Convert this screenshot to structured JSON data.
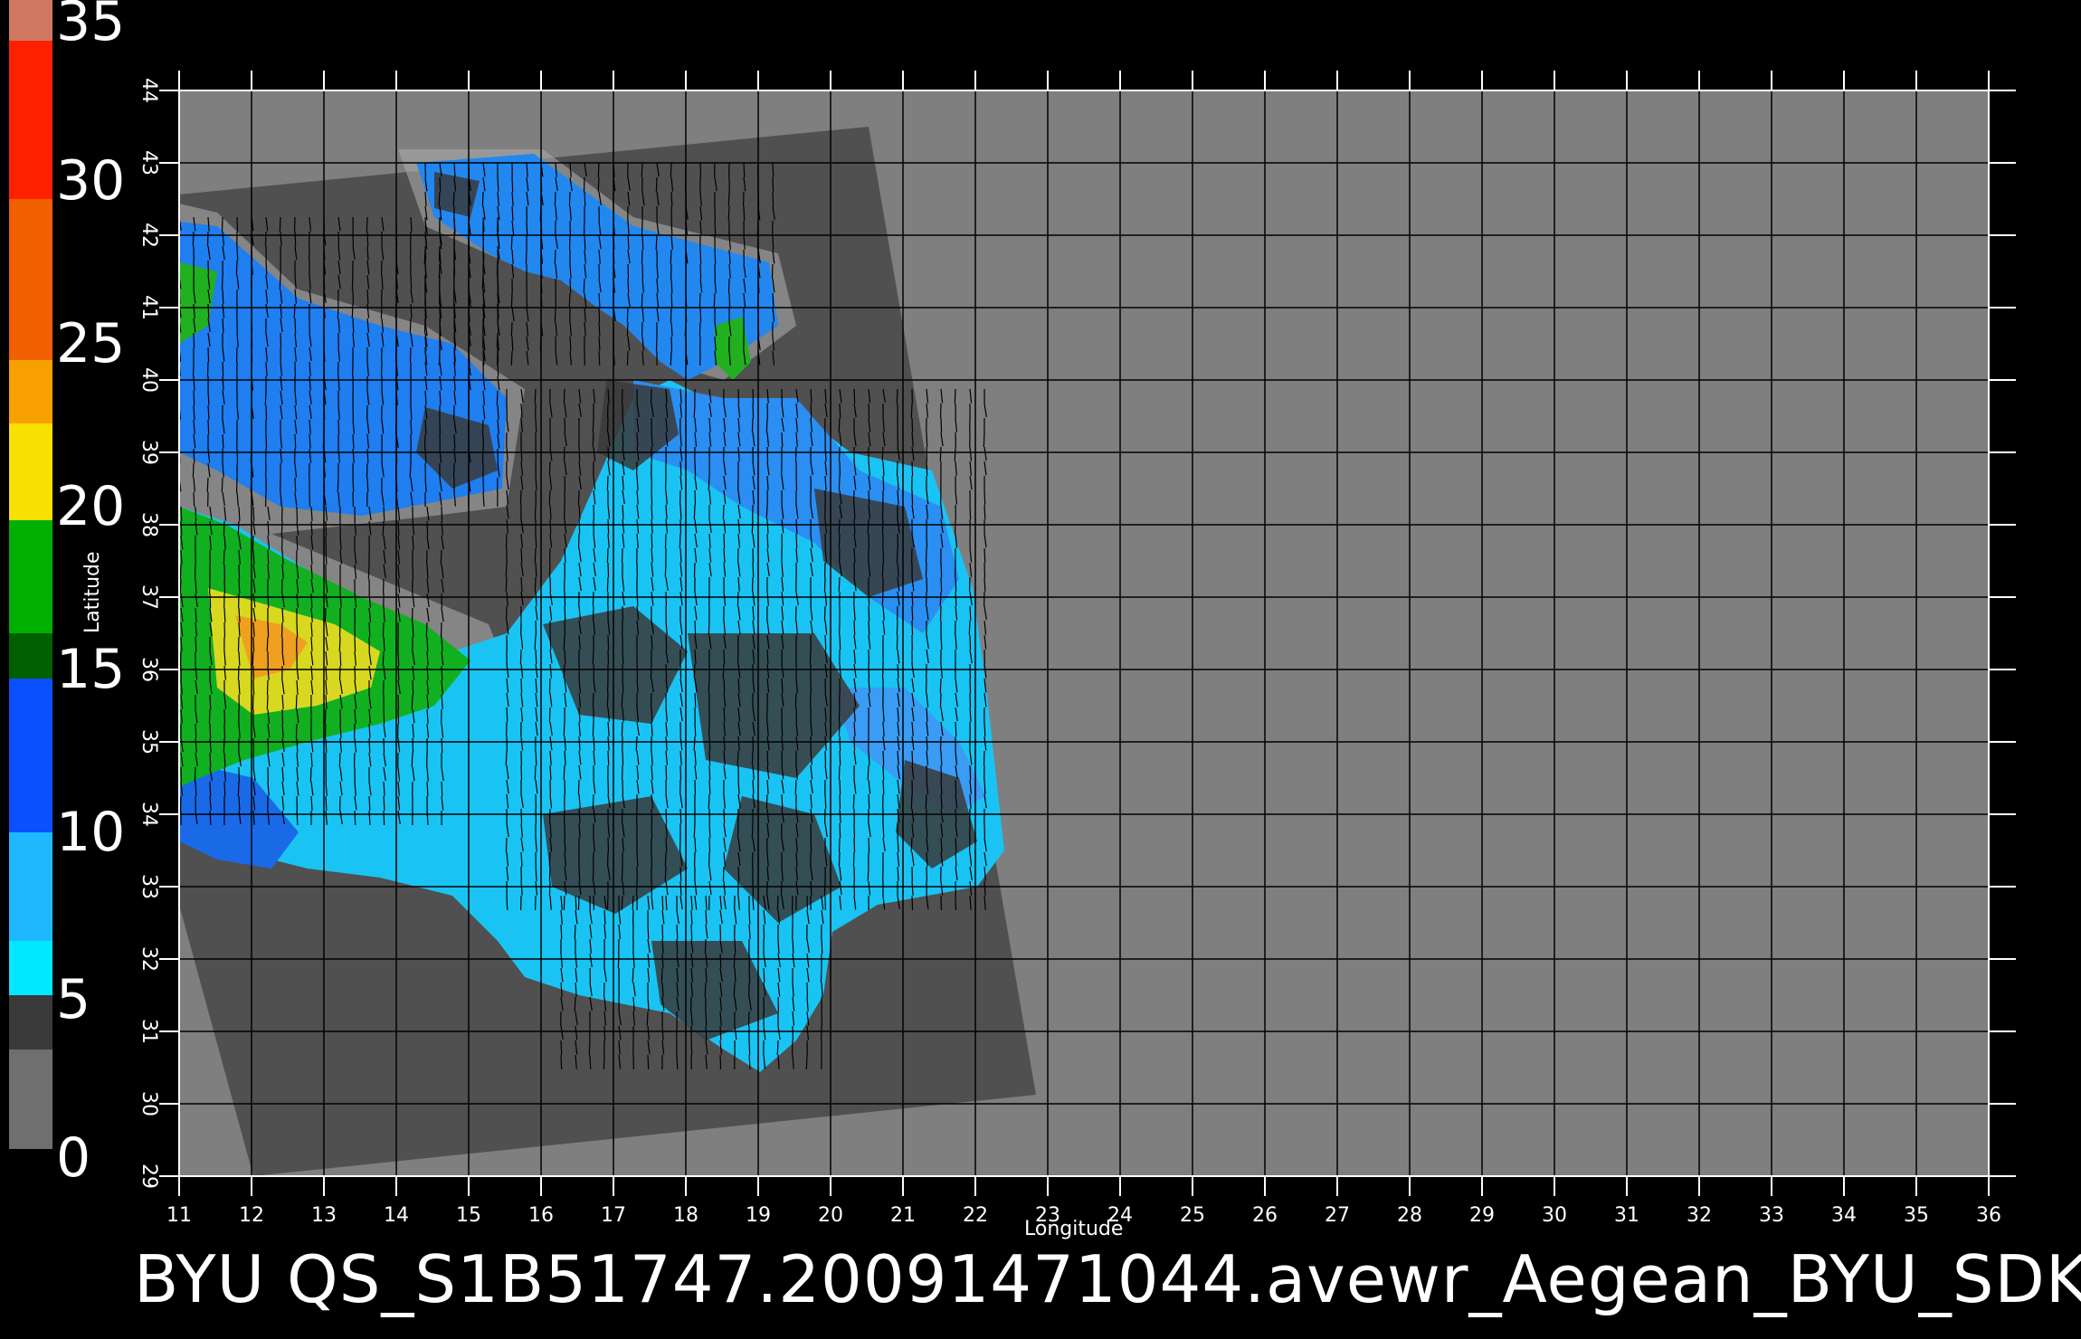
{
  "footer": {
    "title": "BYU  QS_S1B51747.20091471044.avewr_Aegean_BYU_SDK"
  },
  "axes": {
    "xlabel": "Longitude",
    "ylabel": "Latitude",
    "x_ticks": [
      "11",
      "12",
      "13",
      "14",
      "15",
      "16",
      "17",
      "18",
      "19",
      "20",
      "21",
      "22",
      "23",
      "24",
      "25",
      "26",
      "27",
      "28",
      "29",
      "30",
      "31",
      "32",
      "33",
      "34",
      "35",
      "36"
    ],
    "y_ticks": [
      "29",
      "30",
      "31",
      "32",
      "33",
      "34",
      "35",
      "36",
      "37",
      "38",
      "39",
      "40",
      "41",
      "42",
      "43",
      "44"
    ]
  },
  "colorbar": {
    "labels": [
      "35",
      "30",
      "25",
      "20",
      "15",
      "10",
      "5",
      "0"
    ],
    "colors": {
      "gray": "#6f6f6f",
      "dark_gray": "#3a3a3a",
      "cyan": "#00e8ff",
      "light_blue": "#2f9cff",
      "blue": "#0030ff",
      "dark_green": "#006000",
      "green": "#00d000",
      "yellow": "#f8f800",
      "orange": "#f89000",
      "red": "#ff2000",
      "salmon": "#d07860"
    }
  },
  "map_colors": {
    "background": "#000000",
    "no_data": "#7f7f7f",
    "swath": "#505050",
    "coast_buffer": "#a8a8a8",
    "sea_cyan": "#10d8f8",
    "sea_blue": "#2080f0",
    "grid": "#000000"
  }
}
